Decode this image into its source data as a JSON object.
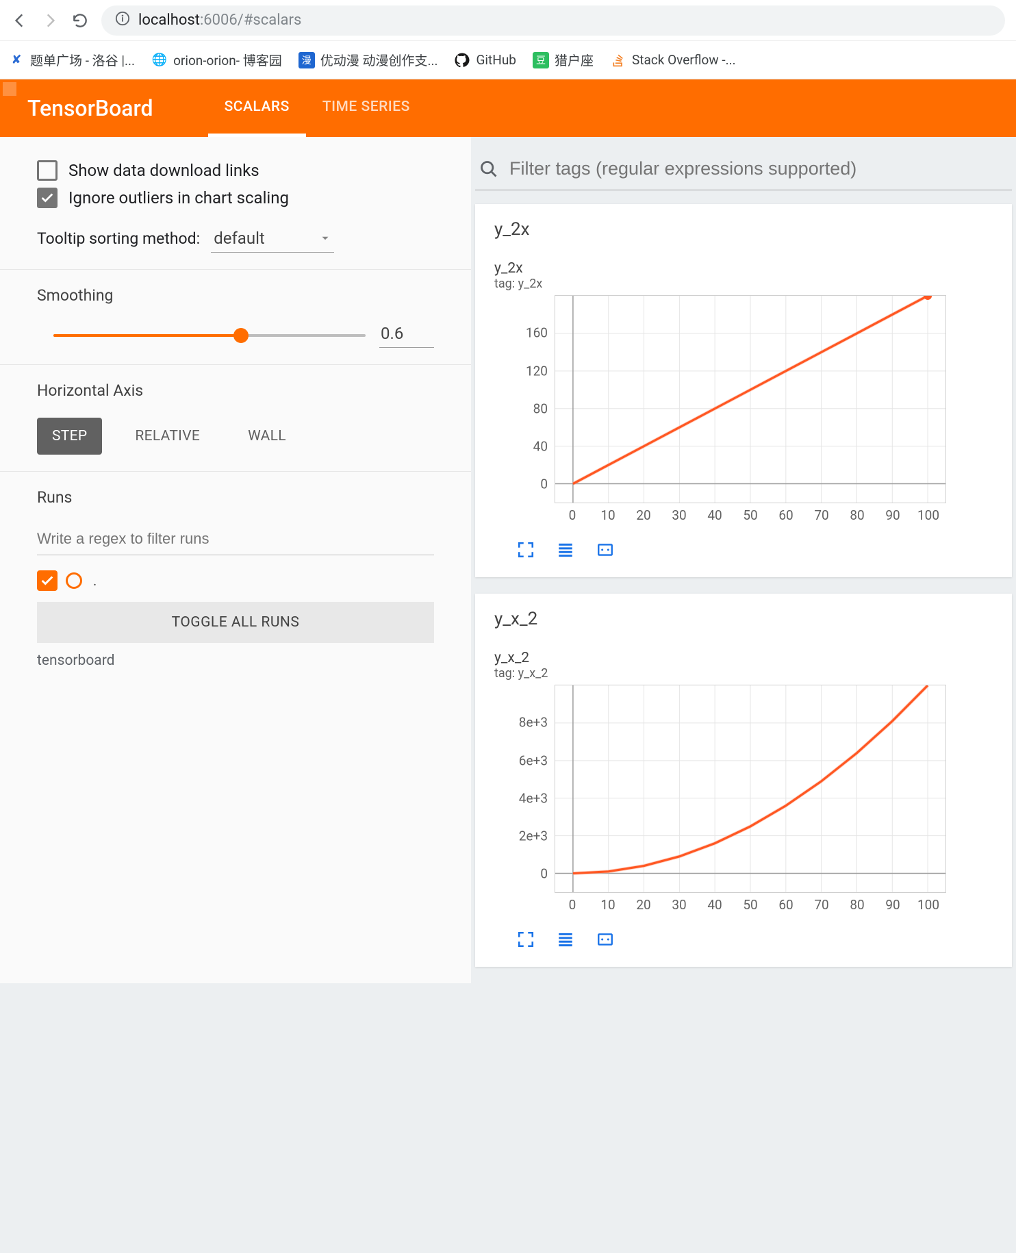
{
  "browser": {
    "url_host": "localhost",
    "url_path": ":6006/#scalars",
    "bookmarks": [
      {
        "label": "题单广场 - 洛谷 |..."
      },
      {
        "label": "orion-orion- 博客园"
      },
      {
        "label": "优动漫 动漫创作支..."
      },
      {
        "label": "GitHub"
      },
      {
        "label": "猎户座"
      },
      {
        "label": "Stack Overflow -..."
      }
    ]
  },
  "header": {
    "logo": "TensorBoard",
    "tabs": [
      {
        "label": "SCALARS",
        "active": true
      },
      {
        "label": "TIME SERIES",
        "active": false
      }
    ]
  },
  "sidebar": {
    "show_download_links": {
      "label": "Show data download links",
      "checked": false
    },
    "ignore_outliers": {
      "label": "Ignore outliers in chart scaling",
      "checked": true
    },
    "tooltip_sort": {
      "label": "Tooltip sorting method:",
      "value": "default"
    },
    "smoothing": {
      "label": "Smoothing",
      "value": "0.6",
      "fraction": 0.6
    },
    "horizontal_axis": {
      "label": "Horizontal Axis",
      "options": [
        "STEP",
        "RELATIVE",
        "WALL"
      ],
      "selected": "STEP"
    },
    "runs": {
      "label": "Runs",
      "filter_placeholder": "Write a regex to filter runs",
      "toggle_all": "TOGGLE ALL RUNS",
      "items": [
        {
          "name": ".",
          "checked": true
        }
      ],
      "footer": "tensorboard"
    }
  },
  "content": {
    "filter_placeholder": "Filter tags (regular expressions supported)",
    "cards": [
      {
        "group_title": "y_2x",
        "chart": {
          "title": "y_2x",
          "tag_line": "tag: y_2x",
          "y_ticks": [
            "0",
            "40",
            "80",
            "120",
            "160"
          ],
          "x_ticks": [
            "0",
            "10",
            "20",
            "30",
            "40",
            "50",
            "60",
            "70",
            "80",
            "90",
            "100"
          ]
        }
      },
      {
        "group_title": "y_x_2",
        "chart": {
          "title": "y_x_2",
          "tag_line": "tag: y_x_2",
          "y_ticks": [
            "0",
            "2e+3",
            "4e+3",
            "6e+3",
            "8e+3"
          ],
          "x_ticks": [
            "0",
            "10",
            "20",
            "30",
            "40",
            "50",
            "60",
            "70",
            "80",
            "90",
            "100"
          ]
        }
      }
    ]
  },
  "chart_data": [
    {
      "type": "line",
      "title": "y_2x",
      "tag": "y_2x",
      "xlabel": "step",
      "ylabel": "",
      "xlim": [
        -5,
        105
      ],
      "ylim": [
        -20,
        200
      ],
      "x": [
        0,
        10,
        20,
        30,
        40,
        50,
        60,
        70,
        80,
        90,
        100
      ],
      "values": [
        0,
        20,
        40,
        60,
        80,
        100,
        120,
        140,
        160,
        180,
        200
      ],
      "series_name": "."
    },
    {
      "type": "line",
      "title": "y_x_2",
      "tag": "y_x_2",
      "xlabel": "step",
      "ylabel": "",
      "xlim": [
        -5,
        105
      ],
      "ylim": [
        -1000,
        10000
      ],
      "x": [
        0,
        10,
        20,
        30,
        40,
        50,
        60,
        70,
        80,
        90,
        100
      ],
      "values": [
        0,
        100,
        400,
        900,
        1600,
        2500,
        3600,
        4900,
        6400,
        8100,
        10000
      ],
      "series_name": "."
    }
  ]
}
